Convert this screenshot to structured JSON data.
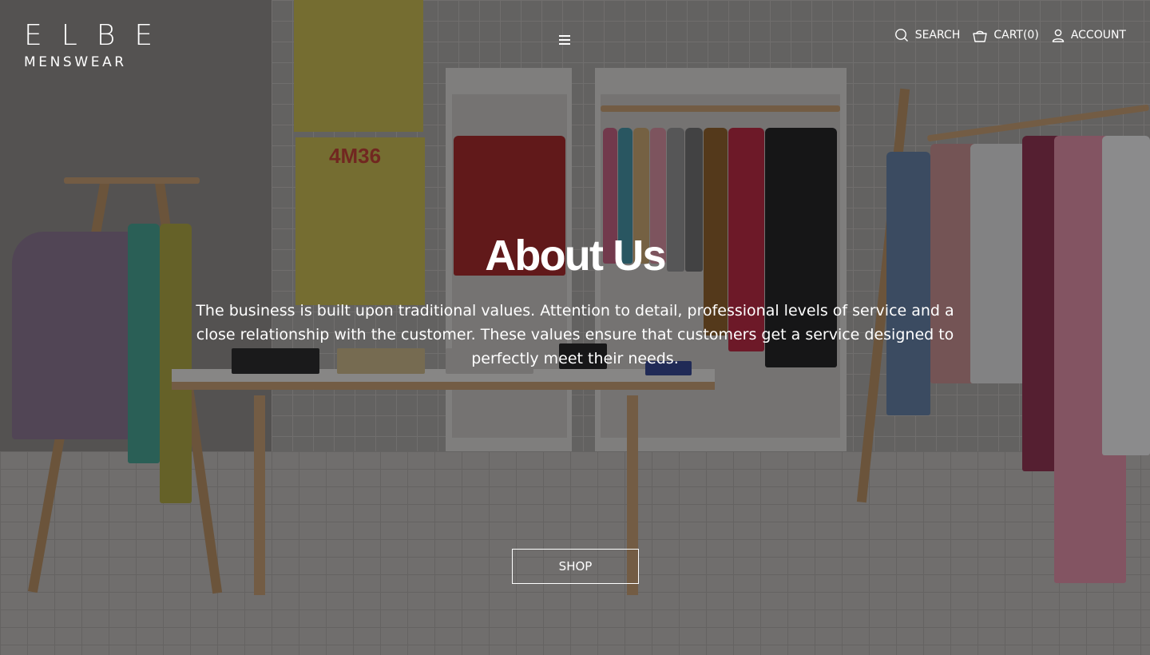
{
  "header": {
    "logo": {
      "main": "ELBE",
      "sub": "MENSWEAR"
    },
    "menu_icon": "hamburger-icon",
    "nav": [
      {
        "label": "SEARCH",
        "icon": "search-icon"
      },
      {
        "label": "CART(0)",
        "icon": "basket-icon"
      },
      {
        "label": "ACCOUNT",
        "icon": "user-icon"
      }
    ]
  },
  "hero": {
    "title": "About Us",
    "intro": "The business is built upon traditional values. Attention to detail, professional levels of service and a close relationship with the customer. These values ensure that customers get a service designed to perfectly meet their needs.",
    "button_label": "SHOP",
    "poster_text": "4M36"
  },
  "colors": {
    "text": "#ffffff",
    "overlay": "#121214"
  }
}
